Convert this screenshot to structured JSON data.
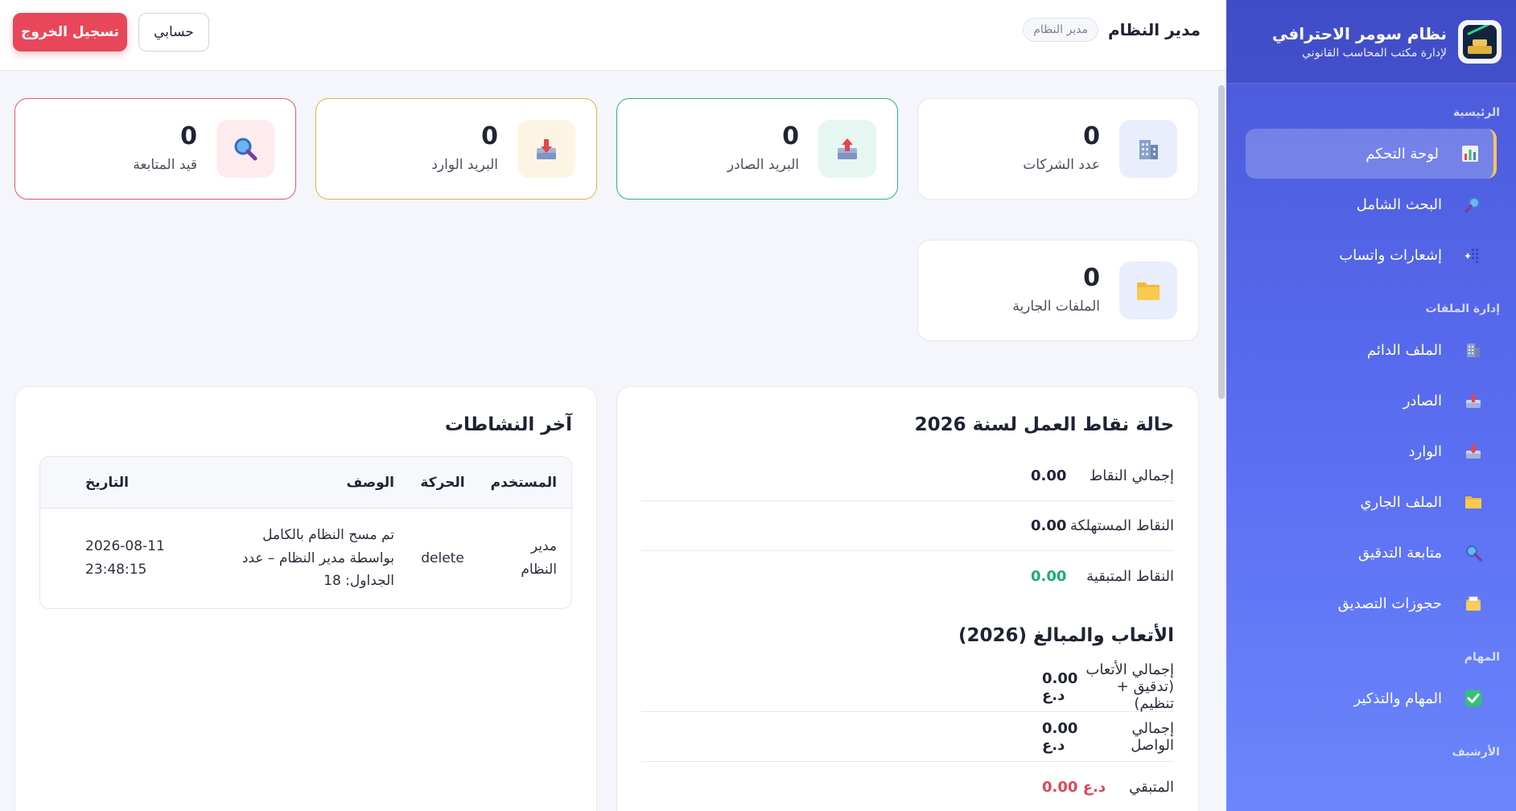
{
  "sidebar": {
    "brand_title": "نظام سومر الاحترافي",
    "brand_subtitle": "لإدارة مكتب المحاسب القانوني",
    "sections": {
      "main": "الرئيسية",
      "files": "إدارة الملفات",
      "tasks": "المهام",
      "archive": "الأرشيف"
    },
    "items": [
      {
        "label": "لوحة التحكم",
        "icon": "bar-chart-icon",
        "active": true
      },
      {
        "label": "البحث الشامل",
        "icon": "search-icon"
      },
      {
        "label": "إشعارات واتساب",
        "icon": "sparkle-grid-icon"
      },
      {
        "label": "الملف الدائم",
        "icon": "building-icon"
      },
      {
        "label": "الصادر",
        "icon": "outbox-icon"
      },
      {
        "label": "الوارد",
        "icon": "inbox-icon"
      },
      {
        "label": "الملف الجاري",
        "icon": "folder-icon"
      },
      {
        "label": "متابعة التدقيق",
        "icon": "search-icon"
      },
      {
        "label": "حجوزات التصديق",
        "icon": "folder-tab-icon"
      },
      {
        "label": "المهام والتذكير",
        "icon": "check-icon"
      }
    ]
  },
  "topbar": {
    "user_name": "مدير النظام",
    "role": "مدير النظام",
    "logout_label": "تسجيل الخروج",
    "account_label": "حسابي"
  },
  "stats": [
    {
      "value": "0",
      "label": "عدد الشركات",
      "icon": "building-icon"
    },
    {
      "value": "0",
      "label": "البريد الصادر",
      "icon": "outbox-icon"
    },
    {
      "value": "0",
      "label": "البريد الوارد",
      "icon": "inbox-icon"
    },
    {
      "value": "0",
      "label": "قيد المتابعة",
      "icon": "magnifier-icon"
    },
    {
      "value": "0",
      "label": "الملفات الجارية",
      "icon": "folder-icon"
    }
  ],
  "points": {
    "title": "حالة نقاط العمل لسنة 2026",
    "rows": [
      {
        "label": "إجمالي النقاط",
        "value": "0.00"
      },
      {
        "label": "النقاط المستهلكة",
        "value": "0.00"
      },
      {
        "label": "النقاط المتبقية",
        "value": "0.00"
      }
    ]
  },
  "fees": {
    "title": "الأتعاب والمبالغ (2026)",
    "rows": [
      {
        "label": "إجمالي الأتعاب (تدقيق + تنظيم)",
        "value": "0.00 د.ع"
      },
      {
        "label": "إجمالي الواصل",
        "value": "0.00 د.ع"
      },
      {
        "label": "المتبقي",
        "value": "0.00 د.ع"
      }
    ]
  },
  "activities": {
    "title": "آخر النشاطات",
    "headers": {
      "user": "المستخدم",
      "move": "الحركة",
      "desc": "الوصف",
      "date": "التاريخ"
    },
    "rows": [
      {
        "user_line1": "مدير",
        "user_line2": "النظام",
        "move": "delete",
        "desc_line1": "تم مسح النظام بالكامل",
        "desc_line2": "بواسطة مدير النظام – عدد",
        "desc_line3": "الجداول: 18",
        "date_line1": "2026-08-11",
        "date_line2": "23:48:15"
      }
    ]
  },
  "colors": {
    "sidebar_top": "#4a57d8",
    "sidebar_bottom": "#6b86fb",
    "logout": "#e8475a",
    "green_value": "#21a97c",
    "red_value": "#e04556"
  }
}
